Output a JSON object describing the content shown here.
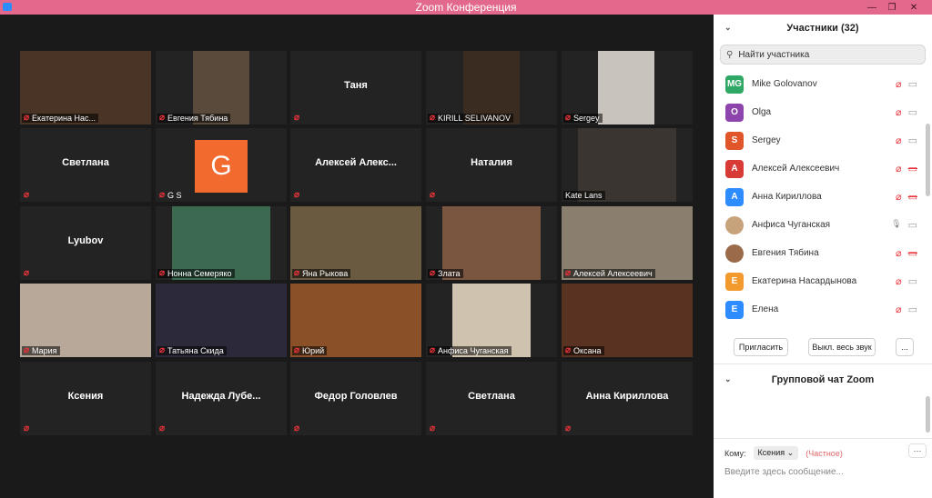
{
  "window": {
    "title": "Zoom Конференция",
    "controls": [
      "—",
      "❐",
      "✕"
    ]
  },
  "gallery": {
    "tiles": [
      {
        "name": "Екатерина Нас...",
        "type": "video",
        "bg": "#4a3426"
      },
      {
        "name": "Евгения Тябина",
        "type": "video",
        "bg": "#5a4a3c"
      },
      {
        "name": "Таня",
        "type": "text"
      },
      {
        "name": "KIRILL SELIVANOV",
        "type": "video",
        "bg": "#3a2c20"
      },
      {
        "name": "Sergey",
        "type": "video",
        "bg": "#c9c3bd"
      },
      {
        "name": "Светлана",
        "type": "text"
      },
      {
        "name": "G S",
        "type": "avatar",
        "avatar_letter": "G"
      },
      {
        "name": "Алексей  Алекс...",
        "type": "text"
      },
      {
        "name": "Наталия",
        "type": "text"
      },
      {
        "name": "Kate Lans",
        "type": "video",
        "bg": "#3a3530"
      },
      {
        "name": "Lyubov",
        "type": "text"
      },
      {
        "name": "Нонна Семеряко",
        "type": "video",
        "bg": "#3b6a50"
      },
      {
        "name": "Яна Рыкова",
        "type": "video",
        "bg": "#6a5a40"
      },
      {
        "name": "Злата",
        "type": "video",
        "bg": "#7a5540"
      },
      {
        "name": "Алексей Алексеевич",
        "type": "video",
        "bg": "#8a7e6e"
      },
      {
        "name": "Мария",
        "type": "video",
        "bg": "#b8a89a"
      },
      {
        "name": "Татьяна Скида",
        "type": "video",
        "bg": "#2c2a3a"
      },
      {
        "name": "Юрий",
        "type": "video",
        "bg": "#8a5028"
      },
      {
        "name": "Анфиса Чуганская",
        "type": "video",
        "bg": "#cfc2ae"
      },
      {
        "name": "Оксана",
        "type": "video",
        "bg": "#5a3222"
      },
      {
        "name": "Ксения",
        "type": "text"
      },
      {
        "name": "Надежда  Лубе...",
        "type": "text"
      },
      {
        "name": "Федор Головлев",
        "type": "text"
      },
      {
        "name": "Светлана",
        "type": "text"
      },
      {
        "name": "Анна Кириллова",
        "type": "text"
      }
    ]
  },
  "panel": {
    "participants_title": "Участники (32)",
    "search_placeholder": "Найти участника",
    "participants": [
      {
        "initials": "MG",
        "name": "Mike Golovanov",
        "color": "#2fa866",
        "mic": "off",
        "cam": "on"
      },
      {
        "initials": "O",
        "name": "Olga",
        "color": "#8e44ad",
        "mic": "off",
        "cam": "on"
      },
      {
        "initials": "S",
        "name": "Sergey",
        "color": "#e0562a",
        "mic": "off",
        "cam": "on"
      },
      {
        "initials": "А",
        "name": "Алексей Алексеевич",
        "color": "#d83a36",
        "mic": "off",
        "cam": "off"
      },
      {
        "initials": "А",
        "name": "Анна Кириллова",
        "color": "#2d8cff",
        "mic": "off",
        "cam": "off"
      },
      {
        "initials": "",
        "name": "Анфиса Чуганская",
        "color": "#c8a27a",
        "mic": "on",
        "cam": "on"
      },
      {
        "initials": "",
        "name": "Евгения Тябина",
        "color": "#9a6a4a",
        "mic": "off",
        "cam": "off"
      },
      {
        "initials": "Е",
        "name": "Екатерина Насардынова",
        "color": "#f29a2e",
        "mic": "off",
        "cam": "on"
      },
      {
        "initials": "E",
        "name": "Елена",
        "color": "#2d8cff",
        "mic": "off",
        "cam": "on"
      }
    ],
    "invite_label": "Пригласить",
    "mute_all_label": "Выкл. весь звук",
    "more_label": "...",
    "chat_title": "Групповой чат Zoom",
    "to_label": "Кому:",
    "to_value": "Ксения",
    "private_label": "(Частное)",
    "chat_placeholder": "Введите здесь сообщение..."
  }
}
